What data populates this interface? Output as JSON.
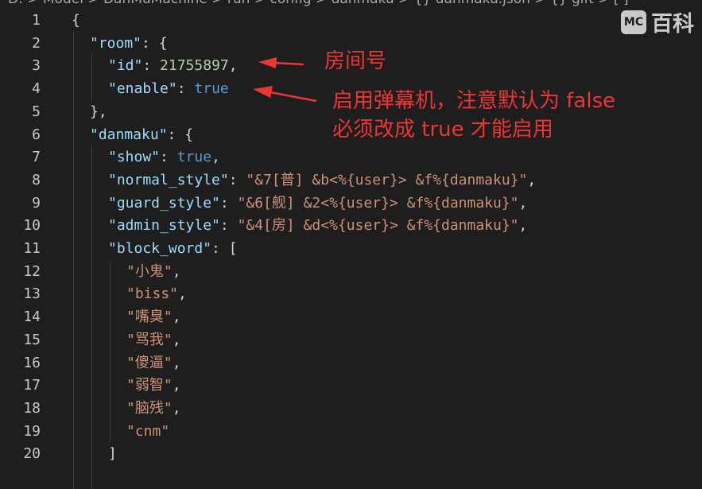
{
  "breadcrumb": "D: > Model > DanMuMachine > run > config > danmaku > {} danmaku.json > {} gift > [ ]",
  "watermark": {
    "logo": "MC",
    "text": "百科"
  },
  "colors": {
    "key": "#9cdcfe",
    "string": "#ce9178",
    "number": "#b5cea8",
    "boolean": "#569cd6",
    "annotation": "#ee3535"
  },
  "lines": [
    {
      "n": "1",
      "indent": 0,
      "tokens": [
        [
          "punc",
          "{"
        ]
      ]
    },
    {
      "n": "2",
      "indent": 1,
      "tokens": [
        [
          "key",
          "\"room\""
        ],
        [
          "punc",
          ": {"
        ]
      ]
    },
    {
      "n": "3",
      "indent": 2,
      "tokens": [
        [
          "key",
          "\"id\""
        ],
        [
          "punc",
          ": "
        ],
        [
          "num",
          "21755897"
        ],
        [
          "punc",
          ","
        ]
      ]
    },
    {
      "n": "4",
      "indent": 2,
      "tokens": [
        [
          "key",
          "\"enable\""
        ],
        [
          "punc",
          ": "
        ],
        [
          "bool",
          "true"
        ]
      ]
    },
    {
      "n": "5",
      "indent": 1,
      "tokens": [
        [
          "punc",
          "},"
        ]
      ]
    },
    {
      "n": "6",
      "indent": 1,
      "tokens": [
        [
          "key",
          "\"danmaku\""
        ],
        [
          "punc",
          ": {"
        ]
      ]
    },
    {
      "n": "7",
      "indent": 2,
      "tokens": [
        [
          "key",
          "\"show\""
        ],
        [
          "punc",
          ": "
        ],
        [
          "bool",
          "true"
        ],
        [
          "punc",
          ","
        ]
      ]
    },
    {
      "n": "8",
      "indent": 2,
      "tokens": [
        [
          "key",
          "\"normal_style\""
        ],
        [
          "punc",
          ": "
        ],
        [
          "str",
          "\"&7[普] &b<%{user}> &f%{danmaku}\""
        ],
        [
          "punc",
          ","
        ]
      ]
    },
    {
      "n": "9",
      "indent": 2,
      "tokens": [
        [
          "key",
          "\"guard_style\""
        ],
        [
          "punc",
          ": "
        ],
        [
          "str",
          "\"&6[舰] &2<%{user}> &f%{danmaku}\""
        ],
        [
          "punc",
          ","
        ]
      ]
    },
    {
      "n": "10",
      "indent": 2,
      "tokens": [
        [
          "key",
          "\"admin_style\""
        ],
        [
          "punc",
          ": "
        ],
        [
          "str",
          "\"&4[房] &d<%{user}> &f%{danmaku}\""
        ],
        [
          "punc",
          ","
        ]
      ]
    },
    {
      "n": "11",
      "indent": 2,
      "tokens": [
        [
          "key",
          "\"block_word\""
        ],
        [
          "punc",
          ": ["
        ]
      ]
    },
    {
      "n": "12",
      "indent": 3,
      "tokens": [
        [
          "str",
          "\"小鬼\""
        ],
        [
          "punc",
          ","
        ]
      ]
    },
    {
      "n": "13",
      "indent": 3,
      "tokens": [
        [
          "str",
          "\"biss\""
        ],
        [
          "punc",
          ","
        ]
      ]
    },
    {
      "n": "14",
      "indent": 3,
      "tokens": [
        [
          "str",
          "\"嘴臭\""
        ],
        [
          "punc",
          ","
        ]
      ]
    },
    {
      "n": "15",
      "indent": 3,
      "tokens": [
        [
          "str",
          "\"骂我\""
        ],
        [
          "punc",
          ","
        ]
      ]
    },
    {
      "n": "16",
      "indent": 3,
      "tokens": [
        [
          "str",
          "\"傻逼\""
        ],
        [
          "punc",
          ","
        ]
      ]
    },
    {
      "n": "17",
      "indent": 3,
      "tokens": [
        [
          "str",
          "\"弱智\""
        ],
        [
          "punc",
          ","
        ]
      ]
    },
    {
      "n": "18",
      "indent": 3,
      "tokens": [
        [
          "str",
          "\"脑残\""
        ],
        [
          "punc",
          ","
        ]
      ]
    },
    {
      "n": "19",
      "indent": 3,
      "tokens": [
        [
          "str",
          "\"cnm\""
        ]
      ]
    },
    {
      "n": "20",
      "indent": 2,
      "tokens": [
        [
          "punc",
          "]"
        ]
      ]
    }
  ],
  "annotations": {
    "room_id": "房间号",
    "enable_line1": "启用弹幕机，注意默认为 false",
    "enable_line2": "必须改成 true 才能启用"
  }
}
